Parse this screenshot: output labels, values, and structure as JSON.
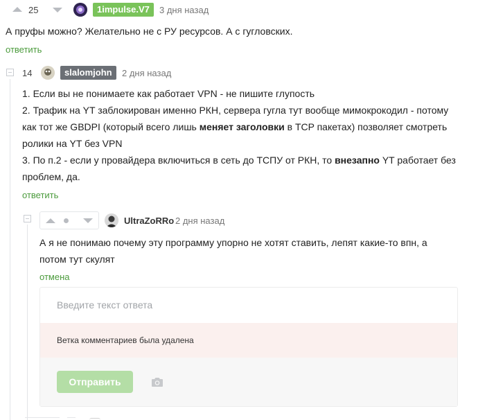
{
  "comments": [
    {
      "score": "25",
      "username": "1impulse.V7",
      "user_color": "#7ac35a",
      "time": "3 дня назад",
      "body": "А пруфы можно? Желательно не с РУ ресурсов. А с гугловских.",
      "reply_label": "ответить"
    },
    {
      "score": "14",
      "username": "slalomjohn",
      "user_color": "#6b6f75",
      "time": "2 дня назад",
      "paragraphs": {
        "p1": "1. Если вы не понимаете как работает VPN - не пишите глупость",
        "p2_a": "2. Трафик на YT заблокирован именно РКН, сервера гугла тут вообще мимокрокодил - потому как тот же GBDPI (который всего лишь ",
        "p2_bold": "меняет заголовки",
        "p2_b": " в TCP пакетах) позволяет смотреть ролики на YT без VPN",
        "p3_a": "3. По п.2 - если у провайдера включиться в сеть до ТСПУ от РКН, то ",
        "p3_bold": "внезапно",
        "p3_b": " YT работает без проблем, да."
      },
      "reply_label": "ответить"
    },
    {
      "username": "UltraZoRRo",
      "time": "2 дня назад",
      "body": "А я не понимаю почему эту программу упорно не хотят ставить, лепят какие-то впн, а потом тут скулят",
      "cancel_label": "отмена"
    }
  ],
  "reply_form": {
    "placeholder": "Введите текст ответа",
    "deleted_notice": "Ветка комментариев была удалена",
    "submit_label": "Отправить"
  },
  "colors": {
    "accent_green": "#4b9b3c",
    "button_green_disabled": "#b4dea6",
    "notice_bg": "#fbf0ee"
  },
  "icons": [
    "arrow-up-icon",
    "arrow-down-icon",
    "collapse-icon",
    "camera-icon",
    "avatar"
  ]
}
